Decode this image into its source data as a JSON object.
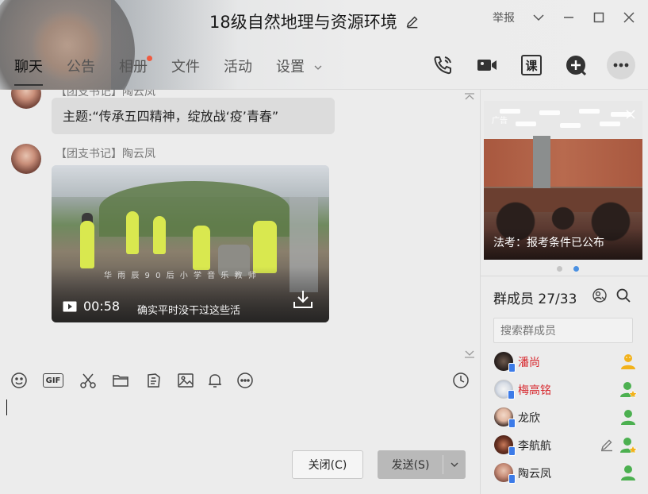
{
  "window": {
    "title": "18级自然地理与资源环境",
    "report_label": "举报"
  },
  "tabs": [
    {
      "label": "聊天",
      "active": true
    },
    {
      "label": "公告"
    },
    {
      "label": "相册",
      "has_dot": true
    },
    {
      "label": "文件"
    },
    {
      "label": "活动"
    },
    {
      "label": "设置",
      "has_dropdown": true
    }
  ],
  "tool_icons": {
    "class_label": "课"
  },
  "chat": {
    "messages": [
      {
        "sender": "【团支书记】陶云凤",
        "text": "主题:“传承五四精神，绽放战‘疫’青春”"
      },
      {
        "sender": "【团支书记】陶云凤",
        "type": "video",
        "duration": "00:58",
        "subtitle": "华 雨 辰   9 0 后 小 学 音 乐 教 师",
        "caption": "确实平时没干过这些活"
      }
    ]
  },
  "input": {
    "value": ""
  },
  "actions": {
    "close_label": "关闭(C)",
    "send_label": "发送(S)"
  },
  "ad": {
    "tag": "广告",
    "caption": "法考：报考条件已公布",
    "slide_count": 2,
    "active_slide": 2
  },
  "members": {
    "title": "群成员 27/33",
    "search_placeholder": "搜索群成员",
    "list": [
      {
        "name": "潘尚",
        "name_color": "#d7262c",
        "role": "owner"
      },
      {
        "name": "梅高铭",
        "name_color": "#d7262c",
        "role": "admin"
      },
      {
        "name": "龙欣",
        "name_color": "#222222",
        "role": "member"
      },
      {
        "name": "李航航",
        "name_color": "#222222",
        "role": "admin"
      },
      {
        "name": "陶云凤",
        "name_color": "#222222",
        "role": "member"
      }
    ]
  },
  "colors": {
    "accent_blue": "#4a90e2",
    "owner_yellow": "#f2b21b",
    "member_green": "#4cb050",
    "admin_red_name": "#d7262c"
  }
}
